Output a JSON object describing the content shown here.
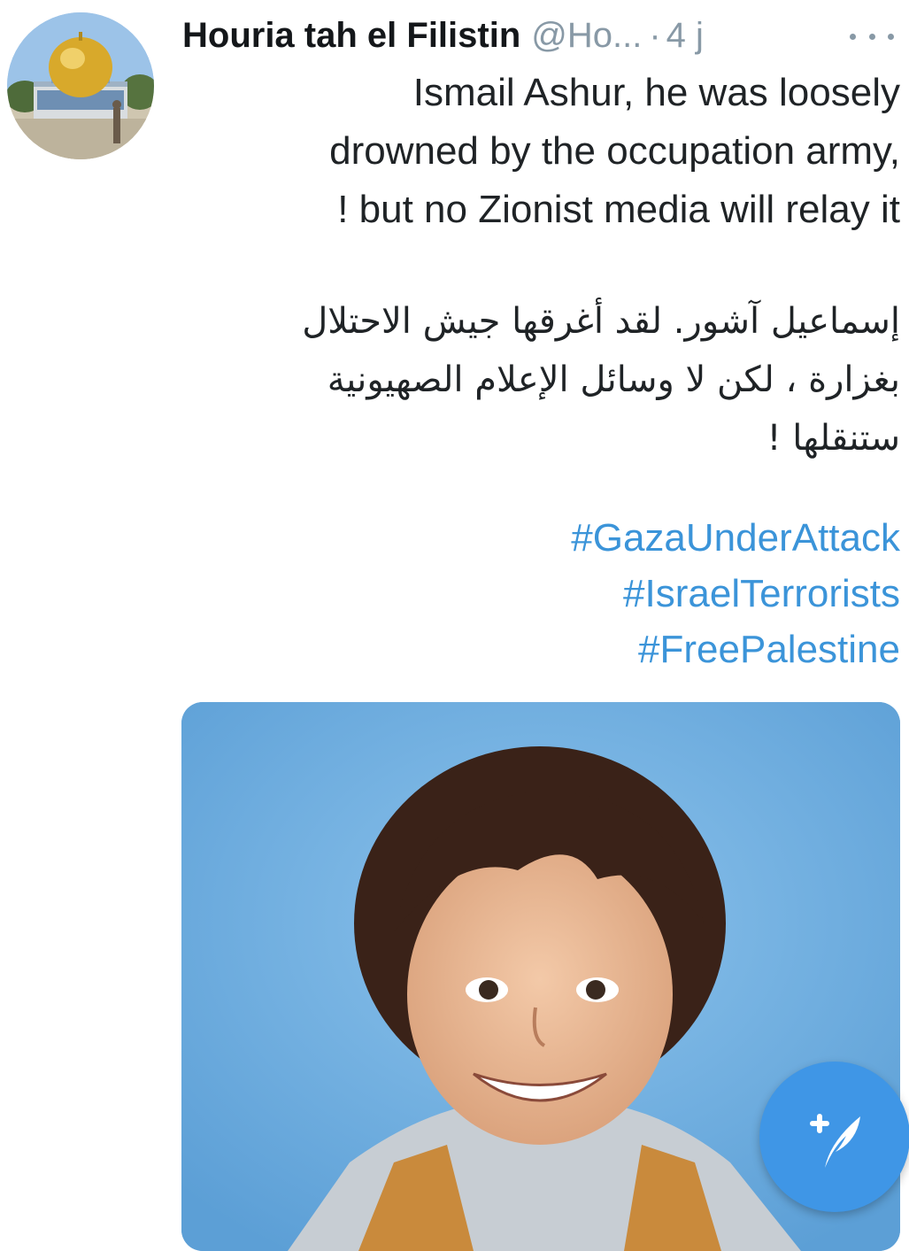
{
  "tweet": {
    "display_name": "Houria tah el Filistin",
    "handle": "@Ho...",
    "separator": "·",
    "timestamp": "4 j",
    "more_icon": "more-horizontal-icon",
    "text_lines": [
      "Ismail Ashur, he was loosely",
      "drowned by the occupation army,",
      "! but no Zionist media will relay it"
    ],
    "arabic_lines": [
      "إسماعيل آشور. لقد أغرقها جيش الاحتلال",
      "بغزارة ، لكن لا وسائل الإعلام الصهيونية",
      "ستنقلها !"
    ],
    "hashtags": [
      "#GazaUnderAttack",
      "#IsraelTerrorists",
      "#FreePalestine"
    ]
  },
  "compose_button": {
    "icon": "compose-feather-plus-icon",
    "color": "#3f96e6"
  },
  "colors": {
    "link": "#3b94d9",
    "muted": "#8899a6",
    "text": "#14171a",
    "media_background": "#6aa9df"
  }
}
